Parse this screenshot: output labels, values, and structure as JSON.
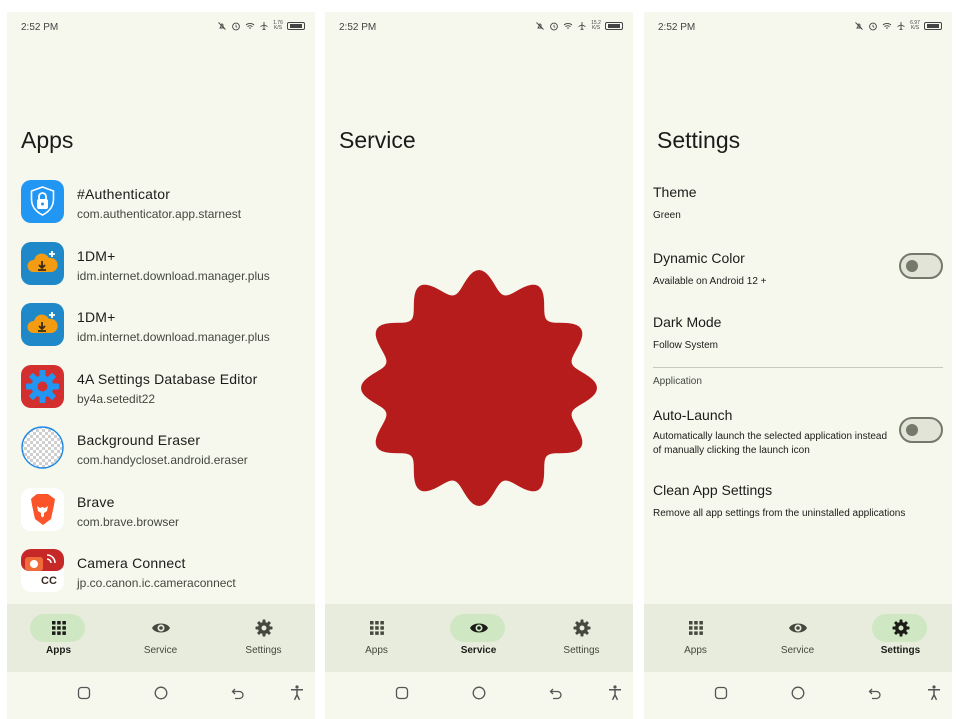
{
  "status": {
    "time": "2:52 PM",
    "speed_1": "1.76 K/S",
    "speed_2": "15.2 K/S",
    "speed_3": "6.97 K/S"
  },
  "apps_screen": {
    "title": "Apps",
    "apps": [
      {
        "name": "#Authenticator",
        "package": "com.authenticator.app.starnest"
      },
      {
        "name": "1DM+",
        "package": "idm.internet.download.manager.plus"
      },
      {
        "name": "1DM+",
        "package": "idm.internet.download.manager.plus"
      },
      {
        "name": "4A Settings Database Editor",
        "package": "by4a.setedit22"
      },
      {
        "name": "Background Eraser",
        "package": "com.handycloset.android.eraser"
      },
      {
        "name": "Brave",
        "package": "com.brave.browser"
      },
      {
        "name": "Camera Connect",
        "package": "jp.co.canon.ic.cameraconnect"
      }
    ],
    "camera_icon_text": "CC"
  },
  "service_screen": {
    "title": "Service",
    "badge_color": "#b71c1c"
  },
  "settings_screen": {
    "title": "Settings",
    "theme": {
      "title": "Theme",
      "subtitle": "Green"
    },
    "dynamic_color": {
      "title": "Dynamic Color",
      "subtitle": "Available on Android 12 +",
      "enabled": false
    },
    "dark_mode": {
      "title": "Dark Mode",
      "subtitle": "Follow System"
    },
    "section_label": "Application",
    "auto_launch": {
      "title": "Auto-Launch",
      "subtitle": "Automatically launch the selected application instead of manually clicking the launch icon",
      "enabled": false
    },
    "clean": {
      "title": "Clean App Settings",
      "subtitle": "Remove all app settings from the uninstalled applications"
    }
  },
  "nav": {
    "apps": "Apps",
    "service": "Service",
    "settings": "Settings"
  },
  "colors": {
    "background": "#f6f8ee",
    "nav_bar": "#e8ecdd",
    "active_pill": "#cfe7c2",
    "accent": "#b71c1c"
  }
}
